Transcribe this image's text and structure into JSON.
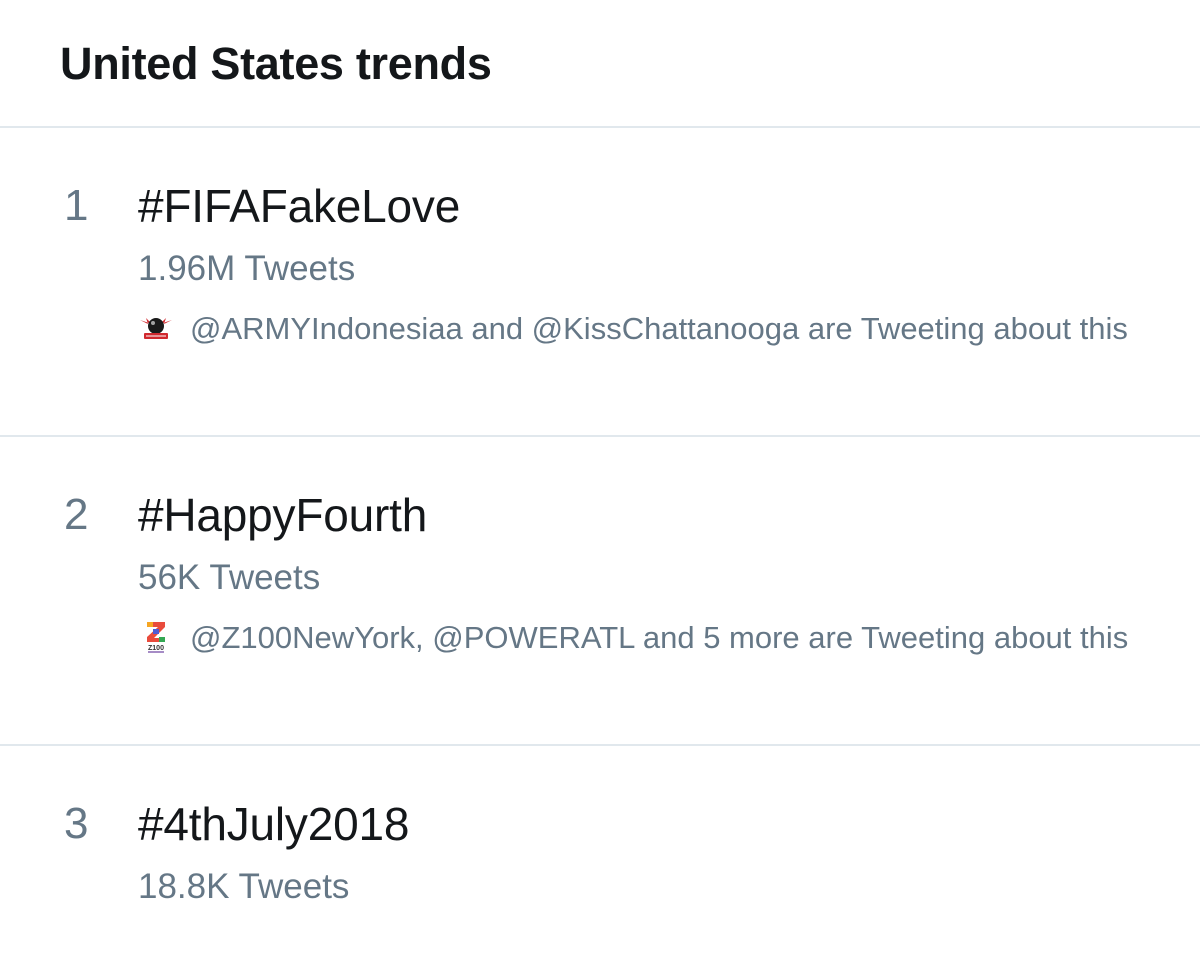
{
  "header": {
    "title": "United States trends"
  },
  "trends": [
    {
      "rank": "1",
      "hashtag": "#FIFAFakeLove",
      "tweet_count": "1.96M Tweets",
      "context_icon": "army-avatar-icon",
      "context_text": "@ARMYIndonesiaa and @KissChattanooga are Tweeting about this"
    },
    {
      "rank": "2",
      "hashtag": "#HappyFourth",
      "tweet_count": "56K Tweets",
      "context_icon": "z100-avatar-icon",
      "context_text": "@Z100NewYork, @POWERATL and 5 more are Tweeting about this"
    },
    {
      "rank": "3",
      "hashtag": "#4thJuly2018",
      "tweet_count": "18.8K Tweets"
    }
  ],
  "colors": {
    "primary_text": "#14171a",
    "secondary_text": "#657786",
    "divider": "#e1e8ed",
    "background": "#ffffff"
  }
}
